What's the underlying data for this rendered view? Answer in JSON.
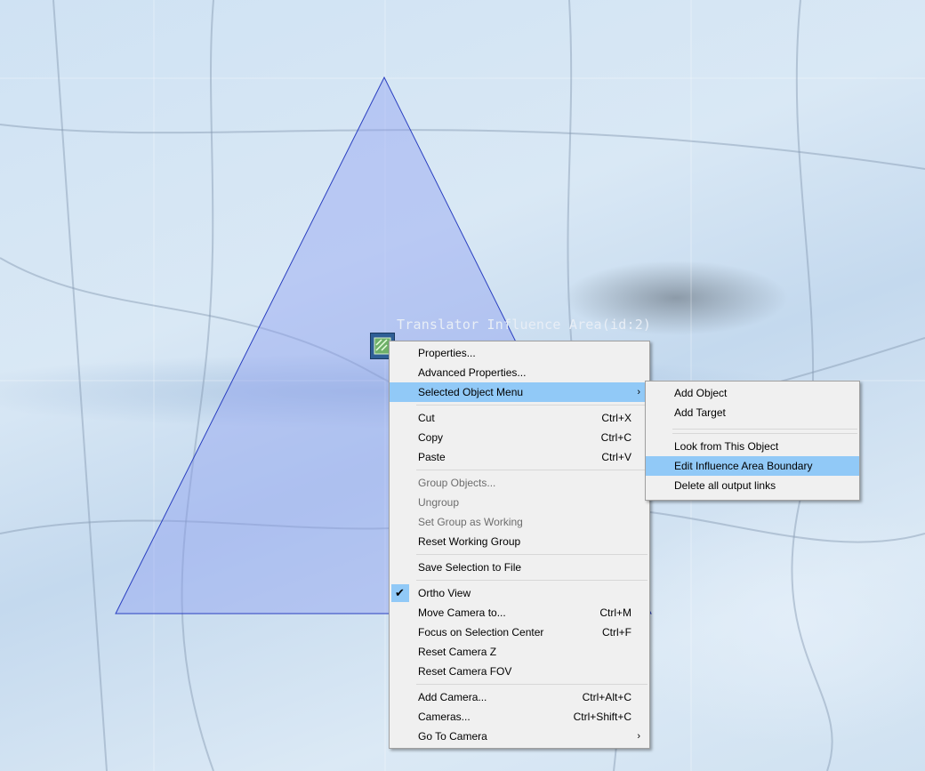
{
  "viewport": {
    "object_label": "Translator Influence Area(id:2)",
    "object_icon": "translator-object-icon"
  },
  "context_menu": {
    "items": [
      {
        "label": "Properties..."
      },
      {
        "label": "Advanced Properties..."
      },
      {
        "label": "Selected Object Menu",
        "submenu": true,
        "highlighted": true
      },
      {
        "label": "Cut",
        "shortcut": "Ctrl+X"
      },
      {
        "label": "Copy",
        "shortcut": "Ctrl+C"
      },
      {
        "label": "Paste",
        "shortcut": "Ctrl+V"
      },
      {
        "label": "Group Objects...",
        "disabled": true
      },
      {
        "label": "Ungroup",
        "disabled": true
      },
      {
        "label": "Set Group as Working",
        "disabled": true
      },
      {
        "label": "Reset Working Group"
      },
      {
        "label": "Save Selection to File"
      },
      {
        "label": "Ortho View",
        "checked": true
      },
      {
        "label": "Move Camera to...",
        "shortcut": "Ctrl+M"
      },
      {
        "label": "Focus on Selection Center",
        "shortcut": "Ctrl+F"
      },
      {
        "label": "Reset Camera Z"
      },
      {
        "label": "Reset Camera FOV"
      },
      {
        "label": "Add Camera...",
        "shortcut": "Ctrl+Alt+C"
      },
      {
        "label": "Cameras...",
        "shortcut": "Ctrl+Shift+C"
      },
      {
        "label": "Go To Camera",
        "submenu": true
      }
    ]
  },
  "submenu": {
    "items": [
      {
        "label": "Add Object"
      },
      {
        "label": "Add Target"
      },
      {
        "label": "Look from This Object"
      },
      {
        "label": "Edit Influence Area Boundary",
        "highlighted": true
      },
      {
        "label": "Delete all output links"
      }
    ]
  },
  "colors": {
    "highlight": "#91c9f7",
    "menu_bg": "#f0f0f0",
    "triangle_fill": "#8c9ef0",
    "triangle_stroke": "#2a3fc0"
  }
}
